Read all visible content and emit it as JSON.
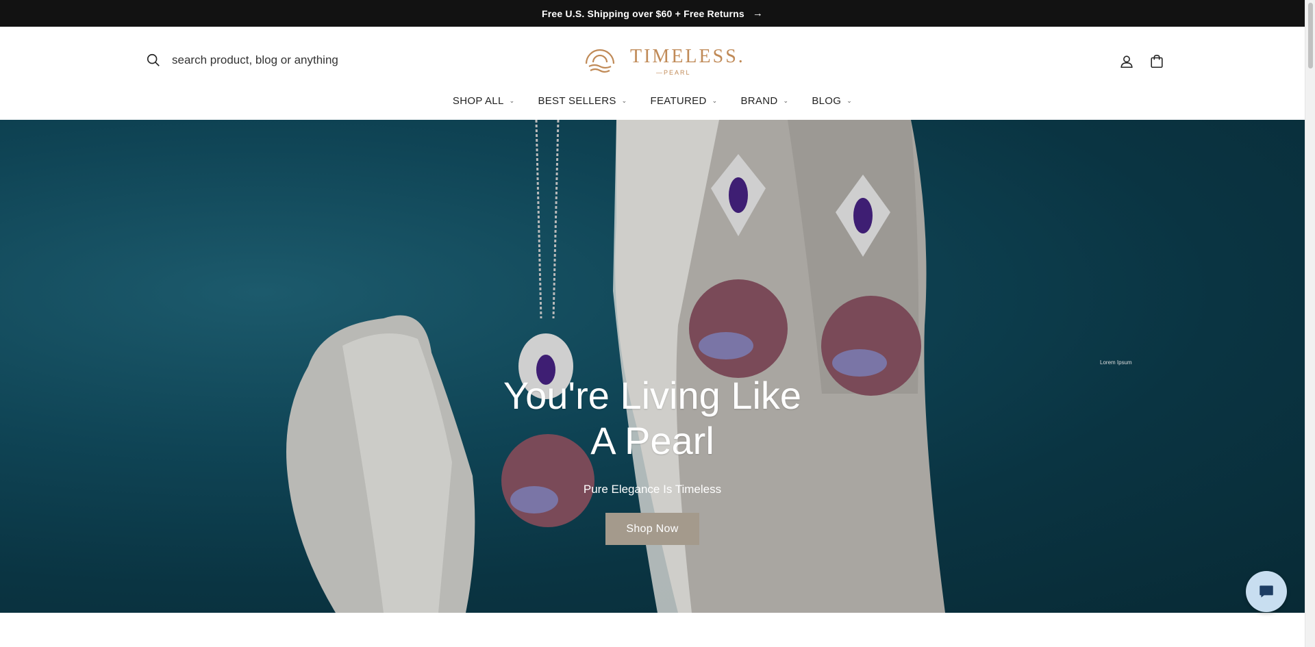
{
  "announcement": {
    "text": "Free U.S. Shipping over $60 + Free Returns",
    "arrow_icon": "arrow-right-icon"
  },
  "header": {
    "search": {
      "placeholder": "search product, blog or anything",
      "icon": "search-icon"
    },
    "logo": {
      "word": "TIMELESS.",
      "sub": "—PEARL"
    },
    "icons": {
      "account": "user-icon",
      "cart": "cart-icon"
    }
  },
  "nav": {
    "items": [
      {
        "label": "SHOP ALL"
      },
      {
        "label": "BEST SELLERS"
      },
      {
        "label": "FEATURED"
      },
      {
        "label": "BRAND"
      },
      {
        "label": "BLOG"
      }
    ]
  },
  "hero": {
    "title_line1": "You're Living Like",
    "title_line2": "A Pearl",
    "subtitle": "Pure Elegance Is Timeless",
    "cta_label": "Shop Now",
    "tiny_text": "Lorem Ipsum"
  },
  "chat": {
    "icon": "chat-bubble-icon"
  },
  "colors": {
    "announce_bg": "#121212",
    "logo": "#c08a57",
    "cta_bg": "#a49a8c",
    "hero_bg": "#0f4455"
  }
}
